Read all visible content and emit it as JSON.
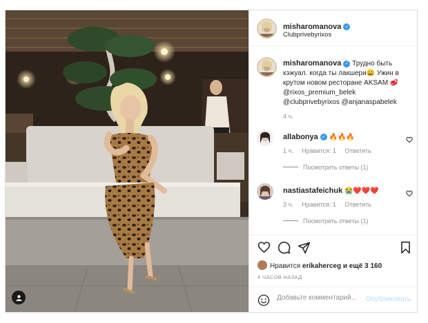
{
  "post": {
    "username": "misharomanova",
    "location": "Clubprivebyrixos",
    "caption_text": "Трудно быть кэжуал. когда ты лакшери😄 Ужин в крутом новом ресторане AKSAM 🥩 @rixos_premium_belek @clubprivebyrixos @anjanaspabelek",
    "caption_time": "4 ч."
  },
  "comments": [
    {
      "username": "allabonya",
      "text": "🔥🔥🔥",
      "time": "1 ч.",
      "likes": "Нравится: 1",
      "reply": "Ответить",
      "view_replies": "Посмотреть ответы (1)"
    },
    {
      "username": "nastiastafeichuk",
      "text": "😭❤️❤️❤️",
      "time": "3 ч.",
      "likes": "Нравится: 1",
      "reply": "Ответить",
      "view_replies": "Посмотреть ответы (1)"
    }
  ],
  "actions": {
    "likes_prefix": "Нравится",
    "likes_user": "erikaherceg",
    "likes_suffix": "и ещё 3 160",
    "time_ago": "4 ЧАСОВ НАЗАД"
  },
  "add_comment": {
    "placeholder": "Добавьте комментарий...",
    "publish_label": "Опубликовать"
  },
  "icons": [
    "heart-icon",
    "comment-icon",
    "share-icon",
    "bookmark-icon",
    "smile-icon",
    "user-tag-icon",
    "verified-icon"
  ],
  "colors": {
    "verified": "#3897f0",
    "publish": "#b2dffc",
    "muted": "#8e8e8e",
    "border": "#dbdbdb"
  }
}
